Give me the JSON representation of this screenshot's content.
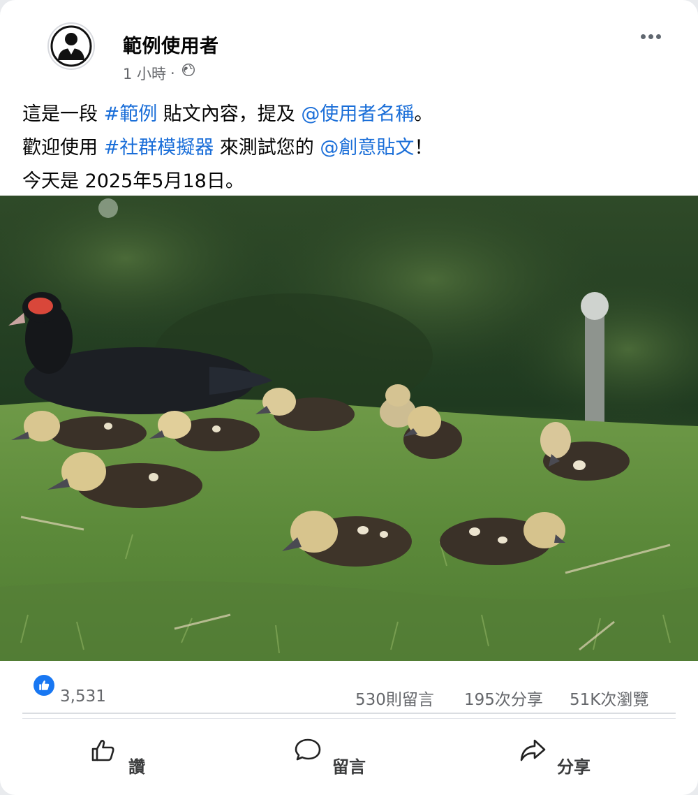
{
  "post": {
    "author": "範例使用者",
    "time": "1 小時",
    "separator": "·",
    "privacy_icon": "globe-icon",
    "more_icon": "more-options-icon",
    "text": {
      "line1": {
        "prefix": "這是一段 ",
        "tag1": "#範例",
        "middle": " 貼文內容，提及 ",
        "mention1": "@使用者名稱",
        "suffix": "。"
      },
      "line2": {
        "prefix": "歡迎使用 ",
        "tag2": "#社群模擬器",
        "middle": " 來測試您的 ",
        "mention2": "@創意貼文",
        "suffix": "！"
      },
      "line3": "今天是 2025年5月18日。"
    },
    "image_subject": "ducklings-on-grass-photo"
  },
  "stats": {
    "likes": "3,531",
    "comments": "530則留言",
    "shares": "195次分享",
    "views": "51K次瀏覽"
  },
  "actions": {
    "like": "讚",
    "comment": "留言",
    "share": "分享"
  },
  "colors": {
    "link": "#1a6ed8",
    "like_badge": "#1877f2",
    "secondary_text": "#65676b"
  }
}
